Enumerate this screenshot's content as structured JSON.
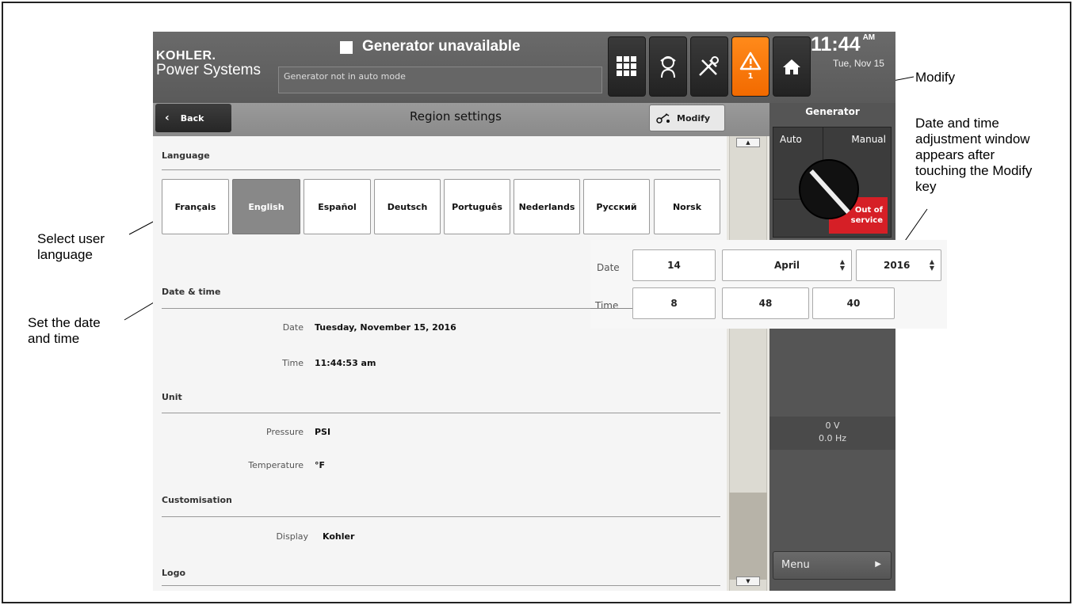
{
  "header": {
    "brand_top": "KOHLER.",
    "brand_bottom": "Power Systems",
    "status_title": "Generator unavailable",
    "status_message": "Generator not in auto mode",
    "alert_count": "1",
    "time": "11:44",
    "ampm": "AM",
    "date": "Tue, Nov 15"
  },
  "nav": {
    "back_label": "Back",
    "title": "Region settings",
    "modify_label": "Modify"
  },
  "language": {
    "heading": "Language",
    "options": [
      "Français",
      "English",
      "Español",
      "Deutsch",
      "Português",
      "Nederlands",
      "Русский",
      "Norsk"
    ],
    "selected": "English"
  },
  "datetime": {
    "heading": "Date & time",
    "date_label": "Date",
    "date_value": "Tuesday, November 15, 2016",
    "time_label": "Time",
    "time_value": "11:44:53 am"
  },
  "unit": {
    "heading": "Unit",
    "pressure_label": "Pressure",
    "pressure_value": "PSI",
    "temperature_label": "Temperature",
    "temperature_value": "°F"
  },
  "customisation": {
    "heading": "Customisation",
    "display_label": "Display",
    "display_value": "Kohler"
  },
  "logo": {
    "heading": "Logo"
  },
  "generator": {
    "title": "Generator",
    "auto": "Auto",
    "manual": "Manual",
    "oos_line1": "Out of",
    "oos_line2": "service",
    "voltage": "0 V",
    "frequency": "0.0 Hz",
    "menu_label": "Menu"
  },
  "adjust": {
    "date_label": "Date",
    "day": "14",
    "month": "April",
    "year": "2016",
    "time_label": "Time",
    "hour": "8",
    "minute": "48",
    "second": "40"
  },
  "callouts": {
    "modify": "Modify",
    "adjust_line1": "Date and time",
    "adjust_line2": "adjustment window",
    "adjust_line3": "appears after",
    "adjust_line4": "touching the Modify",
    "adjust_line5": "key",
    "language_line1": "Select user",
    "language_line2": "language",
    "datetime_line1": "Set the date",
    "datetime_line2": "and time"
  },
  "colors": {
    "alert": "#f26a00",
    "out_of_service": "#d61f26",
    "selected_language": "#888888"
  },
  "icons": [
    "dashboard-grid-icon",
    "technician-icon",
    "tools-icon",
    "warning-icon",
    "home-icon",
    "wrench-icon",
    "chevron-left-icon",
    "chevron-right-icon",
    "spinner-updown-icon"
  ]
}
